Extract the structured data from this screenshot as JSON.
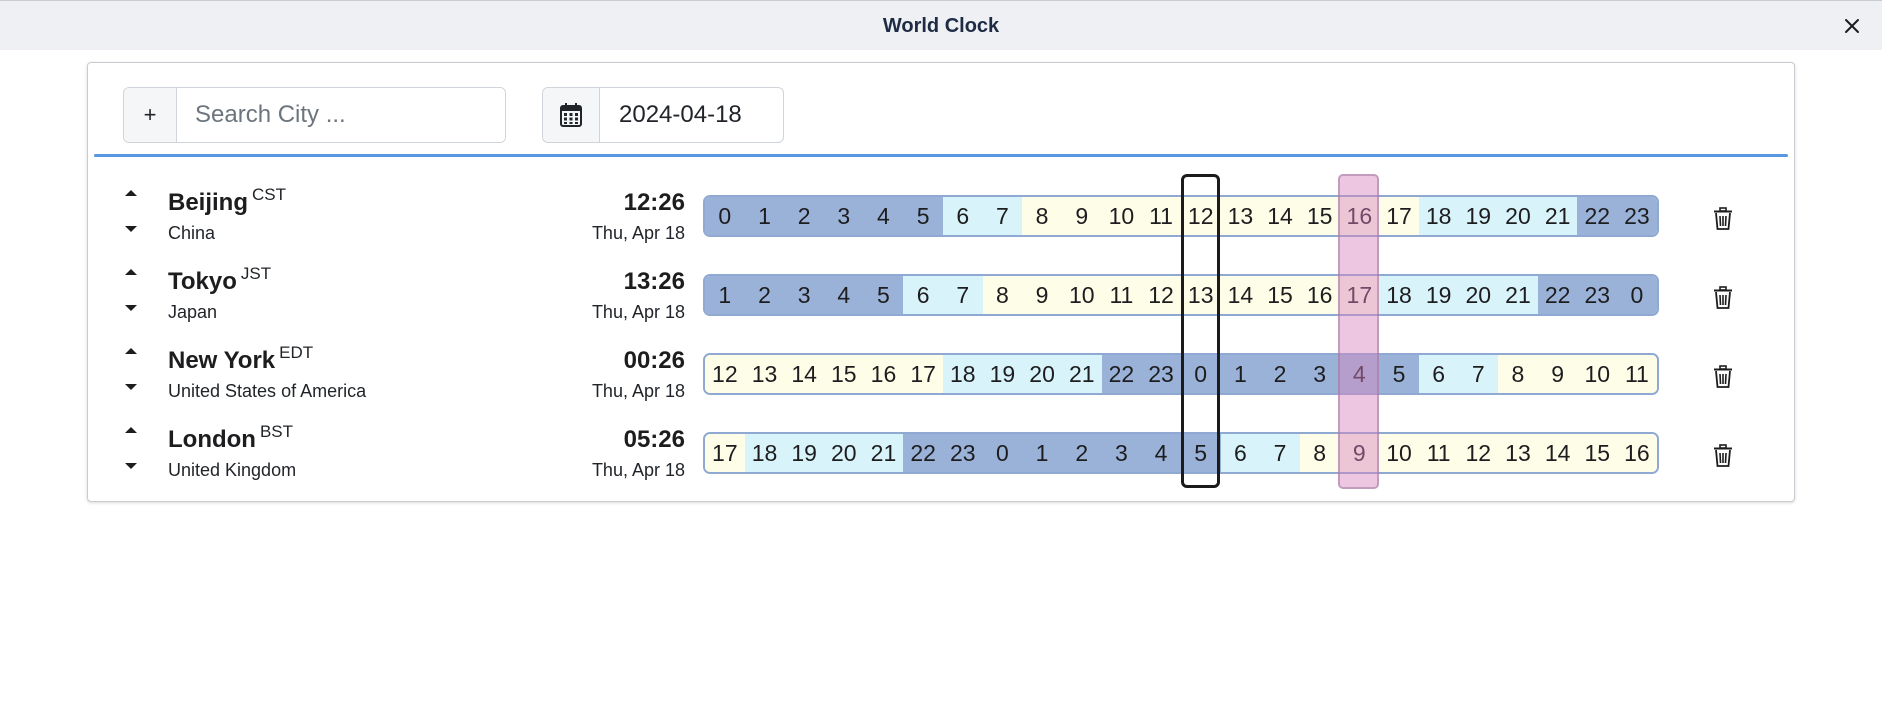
{
  "window": {
    "title": "World Clock"
  },
  "search": {
    "add_label": "+",
    "placeholder": "Search City ..."
  },
  "date_picker": {
    "value": "2024-04-18"
  },
  "colors": {
    "night": "#9ab2d8",
    "evening": "#d8f3f9",
    "day": "#fefde8",
    "accent": "#5a97e3"
  },
  "clocks": [
    {
      "city": "Beijing",
      "abbr": "CST",
      "country": "China",
      "time": "12:26",
      "date": "Thu, Apr 18",
      "hours": [
        0,
        1,
        2,
        3,
        4,
        5,
        6,
        7,
        8,
        9,
        10,
        11,
        12,
        13,
        14,
        15,
        16,
        17,
        18,
        19,
        20,
        21,
        22,
        23
      ]
    },
    {
      "city": "Tokyo",
      "abbr": "JST",
      "country": "Japan",
      "time": "13:26",
      "date": "Thu, Apr 18",
      "hours": [
        1,
        2,
        3,
        4,
        5,
        6,
        7,
        8,
        9,
        10,
        11,
        12,
        13,
        14,
        15,
        16,
        17,
        18,
        19,
        20,
        21,
        22,
        23,
        0
      ]
    },
    {
      "city": "New York",
      "abbr": "EDT",
      "country": "United States of America",
      "time": "00:26",
      "date": "Thu, Apr 18",
      "hours": [
        12,
        13,
        14,
        15,
        16,
        17,
        18,
        19,
        20,
        21,
        22,
        23,
        0,
        1,
        2,
        3,
        4,
        5,
        6,
        7,
        8,
        9,
        10,
        11
      ]
    },
    {
      "city": "London",
      "abbr": "BST",
      "country": "United Kingdom",
      "time": "05:26",
      "date": "Thu, Apr 18",
      "hours": [
        17,
        18,
        19,
        20,
        21,
        22,
        23,
        0,
        1,
        2,
        3,
        4,
        5,
        6,
        7,
        8,
        9,
        10,
        11,
        12,
        13,
        14,
        15,
        16
      ]
    }
  ]
}
